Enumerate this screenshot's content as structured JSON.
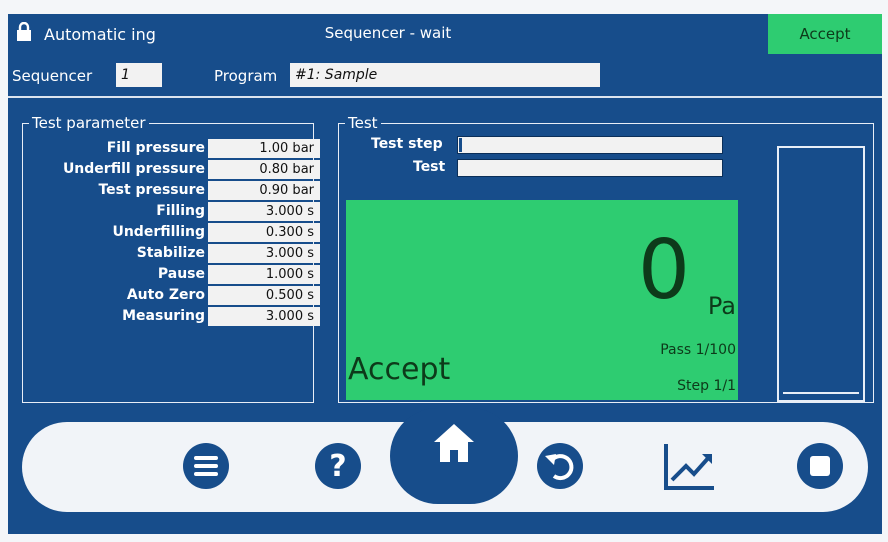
{
  "header": {
    "mode_label": "Automatic ing",
    "sequencer_state": "Sequencer - wait",
    "status": "Accept"
  },
  "info": {
    "sequencer_label": "Sequencer",
    "sequencer_value": "1",
    "program_label": "Program",
    "program_value": "#1: Sample"
  },
  "test_parameter": {
    "title": "Test parameter",
    "rows": [
      {
        "label": "Fill pressure",
        "value": "1.00 bar"
      },
      {
        "label": "Underfill pressure",
        "value": "0.80 bar"
      },
      {
        "label": "Test pressure",
        "value": "0.90 bar"
      },
      {
        "label": "Filling",
        "value": "3.000 s"
      },
      {
        "label": "Underfilling",
        "value": "0.300 s"
      },
      {
        "label": "Stabilize",
        "value": "3.000 s"
      },
      {
        "label": "Pause",
        "value": "1.000 s"
      },
      {
        "label": "Auto Zero",
        "value": "0.500 s"
      },
      {
        "label": "Measuring",
        "value": "3.000 s"
      }
    ]
  },
  "test": {
    "title": "Test",
    "test_step_label": "Test step",
    "test_step_progress": 0.01,
    "test_label": "Test",
    "test_progress": 0,
    "value": "0",
    "unit": "Pa",
    "pass": "Pass 1/100",
    "step": "Step 1/1",
    "result": "Accept",
    "result_color": "#2ecc71",
    "side_bar_level": 0.0
  },
  "colors": {
    "background": "#174d8b",
    "accept_green": "#2ecc71",
    "nav_pill": "#f1f4f8",
    "icon_blue": "#174d8b"
  },
  "nav": {
    "buttons": [
      "menu-icon",
      "help-icon",
      "home-icon",
      "undo-icon",
      "chart-icon",
      "stop-icon"
    ]
  }
}
